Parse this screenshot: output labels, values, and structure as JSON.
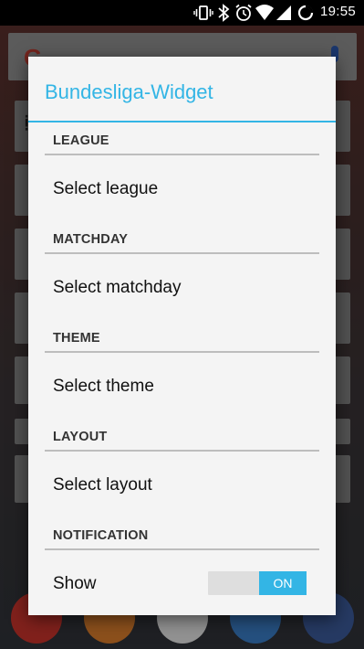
{
  "status_bar": {
    "time": "19:55"
  },
  "dialog": {
    "title": "Bundesliga-Widget",
    "sections": [
      {
        "header": "LEAGUE",
        "item": "Select league"
      },
      {
        "header": "MATCHDAY",
        "item": "Select matchday"
      },
      {
        "header": "THEME",
        "item": "Select theme"
      },
      {
        "header": "LAYOUT",
        "item": "Select layout"
      },
      {
        "header": "NOTIFICATION",
        "item": "Show"
      }
    ],
    "notification_toggle": {
      "state_label": "ON"
    }
  },
  "colors": {
    "accent": "#33b5e5",
    "dialog_bg": "#f4f4f4",
    "divider": "#bdbdbd"
  },
  "background": {
    "search_logo": "G"
  }
}
